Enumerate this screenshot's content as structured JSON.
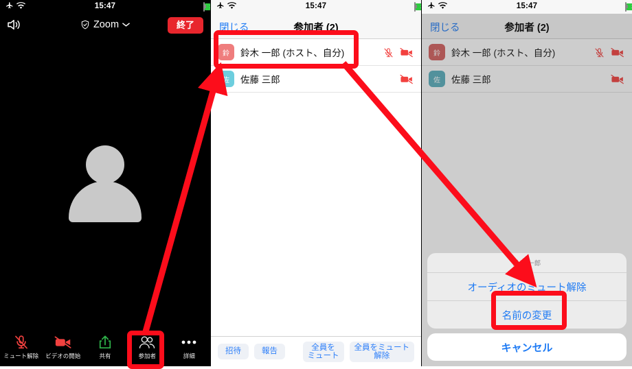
{
  "status_bar": {
    "airplane_icon": "airplane-icon",
    "wifi_icon": "wifi-icon",
    "time": "15:47",
    "battery_icon": "battery-charging-icon"
  },
  "panel1": {
    "nav": {
      "speaker_icon": "speaker-icon",
      "shield_icon": "shield-check-icon",
      "app_name": "Zoom",
      "chevron_icon": "chevron-down-icon",
      "end_label": "終了"
    },
    "video": {
      "avatar_icon": "person-silhouette-icon"
    },
    "toolbar": [
      {
        "icon": "mic-muted-icon",
        "label": "ミュート解除"
      },
      {
        "icon": "video-off-icon",
        "label": "ビデオの開始"
      },
      {
        "icon": "share-up-icon",
        "label": "共有"
      },
      {
        "icon": "participants-icon",
        "label": "参加者"
      },
      {
        "icon": "ellipsis-icon",
        "label": "詳細"
      }
    ]
  },
  "panel2": {
    "nav": {
      "close_label": "閉じる",
      "title": "参加者 (2)"
    },
    "participants": [
      {
        "initial": "鈴",
        "avatar_color": "#ef7d7d",
        "name": "鈴木 一郎 (ホスト、自分)",
        "mic_icon": "mic-muted-icon",
        "video_icon": "video-off-icon"
      },
      {
        "initial": "佐",
        "avatar_color": "#6dcede",
        "name": "佐藤 三郎",
        "mic_icon": "",
        "video_icon": "video-off-icon"
      }
    ],
    "bottom_buttons": [
      {
        "label": "招待"
      },
      {
        "label": "報告"
      },
      {
        "label": "全員を\nミュート"
      },
      {
        "label": "全員をミュート\n解除"
      }
    ]
  },
  "panel3": {
    "nav": {
      "close_label": "閉じる",
      "title": "参加者 (2)"
    },
    "participants": [
      {
        "initial": "鈴",
        "avatar_color": "#d4605f",
        "name": "鈴木 一郎 (ホスト、自分)",
        "mic_icon": "mic-muted-icon",
        "video_icon": "video-off-icon"
      },
      {
        "initial": "佐",
        "avatar_color": "#5aafbd",
        "name": "佐藤 三郎",
        "mic_icon": "",
        "video_icon": "video-off-icon"
      }
    ],
    "action_sheet": {
      "title": "鈴木 一郎",
      "items": [
        {
          "label": "オーディオのミュート解除"
        },
        {
          "label": "名前の変更"
        }
      ],
      "cancel_label": "キャンセル"
    }
  },
  "annotations": {
    "highlight_color": "#fc0d1b",
    "boxes": [
      {
        "name": "participants-button-highlight"
      },
      {
        "name": "participant-row-highlight"
      },
      {
        "name": "rename-option-highlight"
      }
    ],
    "arrows": [
      {
        "name": "arrow-participants-to-list"
      },
      {
        "name": "arrow-row-to-action-sheet"
      }
    ]
  }
}
